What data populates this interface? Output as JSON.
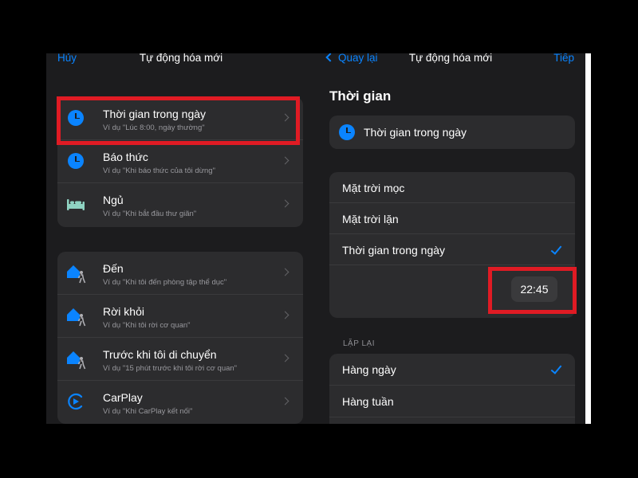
{
  "colors": {
    "accent": "#0a84ff",
    "highlight": "#e01b24",
    "background": "#1c1c1e",
    "cell": "#2c2c2e"
  },
  "left": {
    "nav": {
      "cancel": "Hủy",
      "title": "Tự động hóa mới"
    },
    "group1": [
      {
        "title": "Thời gian trong ngày",
        "subtitle": "Ví dụ \"Lúc 8:00, ngày thường\"",
        "icon": "clock-icon"
      },
      {
        "title": "Báo thức",
        "subtitle": "Ví dụ \"Khi báo thức của tôi dừng\"",
        "icon": "clock-icon"
      },
      {
        "title": "Ngủ",
        "subtitle": "Ví dụ \"Khi bắt đầu thư giãn\"",
        "icon": "bed-icon"
      }
    ],
    "group2": [
      {
        "title": "Đến",
        "subtitle": "Ví dụ \"Khi tôi đến phòng tập thể dục\"",
        "icon": "home-person-icon"
      },
      {
        "title": "Rời khỏi",
        "subtitle": "Ví dụ \"Khi tôi rời cơ quan\"",
        "icon": "home-person-icon"
      },
      {
        "title": "Trước khi tôi di chuyển",
        "subtitle": "Ví dụ \"15 phút trước khi tôi rời cơ quan\"",
        "icon": "home-person-icon"
      },
      {
        "title": "CarPlay",
        "subtitle": "Ví dụ \"Khi CarPlay kết nối\"",
        "icon": "carplay-icon"
      }
    ]
  },
  "right": {
    "nav": {
      "back": "Quay lại",
      "title": "Tự động hóa mới",
      "next": "Tiếp"
    },
    "section_title": "Thời gian",
    "selected_trigger": "Thời gian trong ngày",
    "time_options": [
      "Mặt trời mọc",
      "Mặt trời lặn",
      "Thời gian trong ngày"
    ],
    "time_value": "22:45",
    "repeat_header": "LẶP LẠI",
    "repeat_options": [
      "Hàng ngày",
      "Hàng tuần"
    ]
  }
}
